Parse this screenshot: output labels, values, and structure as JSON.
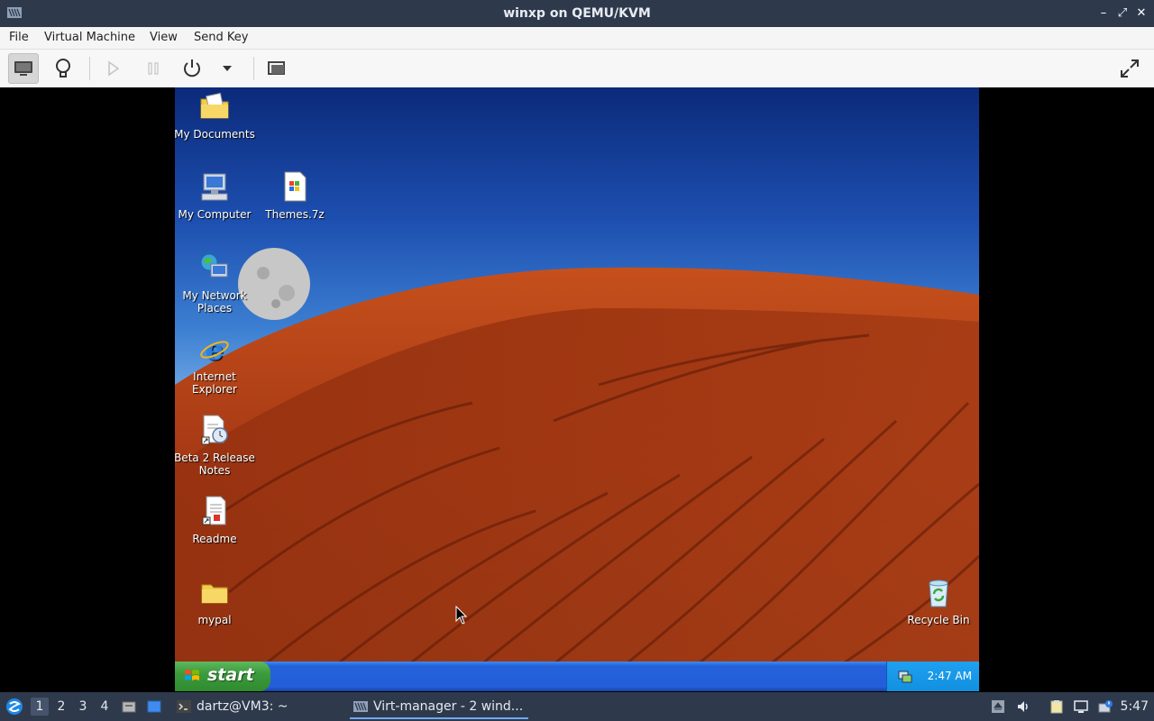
{
  "window": {
    "title": "winxp on QEMU/KVM"
  },
  "menubar": {
    "items": [
      "File",
      "Virtual Machine",
      "View",
      "Send Key"
    ]
  },
  "guest": {
    "desktop_icons": [
      {
        "label": "My Documents",
        "icon": "folder-documents-icon"
      },
      {
        "label": "My Computer",
        "icon": "computer-icon"
      },
      {
        "label": "Themes.7z",
        "icon": "archive-file-icon"
      },
      {
        "label": "My Network Places",
        "icon": "network-places-icon"
      },
      {
        "label": "Internet Explorer",
        "icon": "internet-explorer-icon"
      },
      {
        "label": "Beta 2 Release Notes",
        "icon": "release-notes-icon"
      },
      {
        "label": "Readme",
        "icon": "readme-icon"
      },
      {
        "label": "mypal",
        "icon": "folder-icon"
      },
      {
        "label": "Recycle Bin",
        "icon": "recycle-bin-icon"
      }
    ],
    "taskbar": {
      "start_label": "start",
      "clock": "2:47 AM"
    }
  },
  "panel": {
    "workspaces": [
      "1",
      "2",
      "3",
      "4"
    ],
    "tasks": [
      {
        "label": "dartz@VM3: ~",
        "icon": "terminal-icon"
      },
      {
        "label": "Virt-manager - 2 wind...",
        "icon": "virt-manager-icon"
      }
    ],
    "clock": "5:47"
  },
  "colors": {
    "host_chrome": "#2e3a4c",
    "xp_taskbar": "#245edb",
    "xp_start": "#3c9b3c",
    "dune": "#b8401a"
  }
}
